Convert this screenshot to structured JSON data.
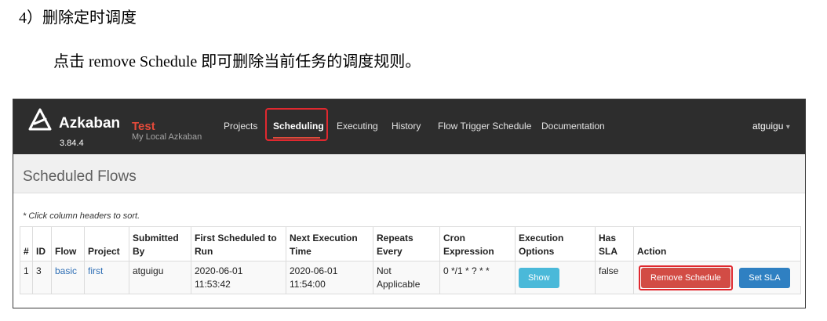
{
  "doc": {
    "heading": "4）删除定时调度",
    "paragraph": "点击 remove Schedule 即可删除当前任务的调度规则。"
  },
  "app": {
    "brand_name": "Azkaban",
    "env_name": "Test",
    "version": "3.84.4",
    "description": "My Local Azkaban",
    "nav": [
      "Projects",
      "Scheduling",
      "Executing",
      "History",
      "Flow Trigger Schedule",
      "Documentation"
    ],
    "active_nav": "Scheduling",
    "user": "atguigu",
    "user_caret": "▾"
  },
  "colors": {
    "navbar_bg": "#2d2d2d",
    "env_red": "#e44a3a",
    "highlight_red": "#e0282f",
    "show_button": "#4ab9d9",
    "remove_button": "#d24c45",
    "sla_button": "#2f80c2",
    "link_blue": "#2f6fb5"
  },
  "icons": [
    "azkaban-logo-icon",
    "chevron-down-icon"
  ],
  "page": {
    "title": "Scheduled Flows",
    "sort_hint": "* Click column headers to sort."
  },
  "table": {
    "headers": {
      "index": "#",
      "id": "ID",
      "flow": "Flow",
      "project": "Project",
      "submitted_by": "Submitted By",
      "first_scheduled": "First Scheduled to Run",
      "next_execution": "Next Execution Time",
      "repeats_every": "Repeats Every",
      "cron": "Cron Expression",
      "exec_options": "Execution Options",
      "has_sla": "Has SLA",
      "action": "Action"
    },
    "row": {
      "index": "1",
      "id": "3",
      "flow": "basic",
      "project": "first",
      "submitted_by": "atguigu",
      "first_scheduled_date": "2020-06-01",
      "first_scheduled_time": "11:53:42",
      "next_execution_date": "2020-06-01",
      "next_execution_time": "11:54:00",
      "repeats_every_1": "Not",
      "repeats_every_2": "Applicable",
      "cron": "0 */1 * ? * *",
      "show_label": "Show",
      "has_sla": "false",
      "remove_label": "Remove Schedule",
      "set_sla_label": "Set SLA"
    }
  }
}
